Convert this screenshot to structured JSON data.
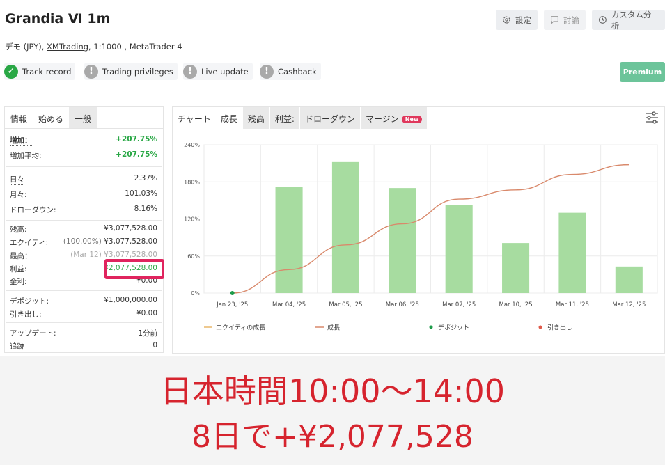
{
  "header": {
    "title": "Grandia Ⅵ 1m",
    "account": "デモ (JPY), ",
    "broker": "XMTrading",
    "account_rest": ", 1:1000 , MetaTrader 4",
    "buttons": {
      "settings": "設定",
      "discussion": "討論",
      "custom": "カスタム分析"
    },
    "badges": [
      "Track record",
      "Trading privileges",
      "Live update",
      "Cashback"
    ],
    "premium": "Premium"
  },
  "left": {
    "tabs": [
      "情報",
      "始める",
      "一般"
    ],
    "rows": [
      {
        "label": "増加：",
        "value": "+207.75%"
      },
      {
        "label": "増加平均:",
        "value": "+207.75%"
      },
      {
        "label": "日々",
        "value": "2.37%"
      },
      {
        "label": "月々:",
        "value": "101.03%"
      },
      {
        "label": "ドローダウン:",
        "value": "8.16%"
      },
      {
        "label": "残高:",
        "value": "¥3,077,528.00"
      },
      {
        "label": "エクイティ:",
        "pct": "(100.00%)",
        "value": "¥3,077,528.00"
      },
      {
        "label": "最高：",
        "pct": "(Mar 12)",
        "value": "¥3,077,528.00"
      },
      {
        "label": "利益:",
        "value": "¥2,077,528.00"
      },
      {
        "label": "金利:",
        "value": "¥0.00"
      },
      {
        "label": "デポジット:",
        "value": "¥1,000,000.00"
      },
      {
        "label": "引き出し:",
        "value": "¥0.00"
      },
      {
        "label": "アップデート:",
        "value": "1分前"
      },
      {
        "label": "追跡",
        "value": "0"
      }
    ]
  },
  "right": {
    "tabs": [
      "チャート",
      "成長",
      "残高",
      "利益:",
      "ドローダウン",
      "マージン"
    ],
    "new_badge": "New"
  },
  "chart_data": {
    "type": "bar",
    "categories": [
      "Jan 23, '25",
      "Mar 04, '25",
      "Mar 05, '25",
      "Mar 06, '25",
      "Mar 07, '25",
      "Mar 10, '25",
      "Mar 11, '25",
      "Mar 12, '25"
    ],
    "series": [
      {
        "name": "成長",
        "type": "bar",
        "values": [
          0,
          172,
          212,
          170,
          142,
          81,
          130,
          43
        ]
      },
      {
        "name": "エクイティの成長",
        "type": "line",
        "values": [
          0,
          38,
          78,
          112,
          152,
          167,
          192,
          207.75
        ]
      }
    ],
    "yticks": [
      "0%",
      "60%",
      "120%",
      "180%",
      "240%"
    ],
    "ylim": [
      0,
      240
    ],
    "legend": [
      "エクイティの成長",
      "成長",
      "デポジット",
      "引き出し"
    ],
    "colors": {
      "bar": "#a7dca0",
      "line": "#d9896b",
      "deposit": "#1e9b4a",
      "withdraw": "#e05a4a",
      "equity_legend": "#e8b76a"
    }
  },
  "caption": {
    "line1": "日本時間10:00〜14:00",
    "line2": "8日で+¥2,077,528"
  }
}
